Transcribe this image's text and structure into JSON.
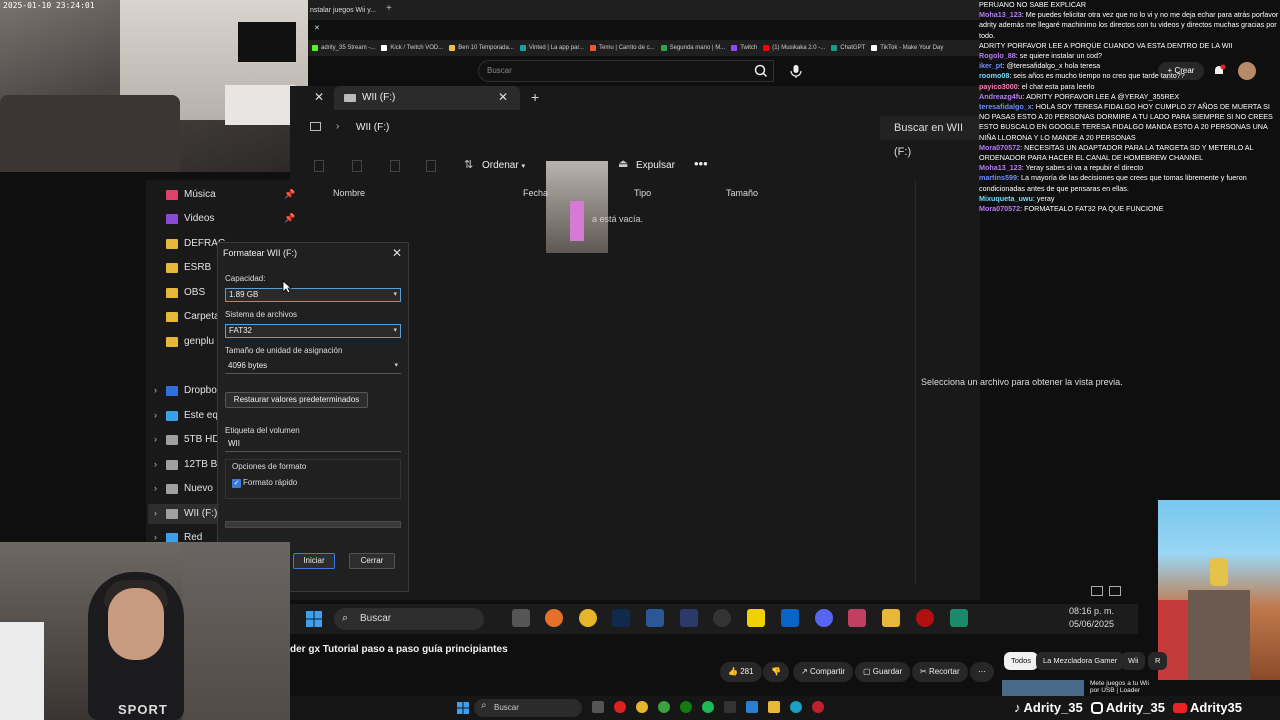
{
  "webcam_top": {
    "timestamp": "2025-01-10 23:24:01"
  },
  "browser": {
    "tab_label": "nstalar juegos Wii y...",
    "search_placeholder": "Buscar",
    "bookmarks": [
      "adrity_35 Stream -...",
      "Kick / Twitch VOD...",
      "Ben 10 Temporada...",
      "Vinted | La app par...",
      "Temu | Carrito de c...",
      "Segunda mano | M...",
      "Twitch",
      "(1) Musikaka 2.0 -...",
      "ChatGPT",
      "TikTok - Make Your Day"
    ],
    "bookmark_colors": [
      "#53fc18",
      "#ffffff",
      "#f0c040",
      "#1aa0a0",
      "#f05a28",
      "#2ea44f",
      "#9146ff",
      "#ff0000",
      "#10a37f",
      "#ffffff"
    ],
    "crear_label": "Crear"
  },
  "explorer": {
    "tab_title": "WII (F:)",
    "address": "WII (F:)",
    "search_label": "Buscar en WII (F:)",
    "toolbar": {
      "ordenar": "Ordenar",
      "expulsar": "Expulsar"
    },
    "columns": {
      "name": "Nombre",
      "date": "Fecha",
      "type": "Tipo",
      "size": "Tamaño"
    },
    "empty_message": "a está vacía.",
    "preview_message": "Selecciona un archivo para obtener la vista previa.",
    "sidebar": [
      {
        "label": "Música",
        "color": "#e0406a",
        "pinned": true
      },
      {
        "label": "Videos",
        "color": "#8a4ad8",
        "pinned": true
      },
      {
        "label": "DEFRAG",
        "color": "#e8b73a",
        "pinned": false
      },
      {
        "label": "ESRB",
        "color": "#e8b73a",
        "pinned": false
      },
      {
        "label": "OBS",
        "color": "#e8b73a",
        "pinned": false
      },
      {
        "label": "Carpeta",
        "color": "#e8b73a",
        "pinned": false
      },
      {
        "label": "genplu",
        "color": "#e8b73a",
        "pinned": false
      },
      {
        "label": "Dropbo",
        "color": "#2f6fe0",
        "pinned": false
      },
      {
        "label": "Este eq",
        "color": "#3aa0e8",
        "pinned": false
      },
      {
        "label": "5TB HD",
        "color": "#a0a0a0",
        "pinned": false
      },
      {
        "label": "12TB B",
        "color": "#a0a0a0",
        "pinned": false
      },
      {
        "label": "Nuevo",
        "color": "#a0a0a0",
        "pinned": false
      },
      {
        "label": "WII (F:)",
        "color": "#a0a0a0",
        "pinned": false
      },
      {
        "label": "Red",
        "color": "#3aa0e8",
        "pinned": false
      }
    ]
  },
  "dialog": {
    "title": "Formatear WII (F:)",
    "capacity_label": "Capacidad:",
    "capacity_value": "1.89 GB",
    "fs_label": "Sistema de archivos",
    "fs_value": "FAT32",
    "alloc_label": "Tamaño de unidad de asignación",
    "alloc_value": "4096 bytes",
    "restore_button": "Restaurar valores predeterminados",
    "volume_label": "Etiqueta del volumen",
    "volume_value": "WII",
    "options_label": "Opciones de formato",
    "quick_format_label": "Formato rápido",
    "quick_format_checked": true,
    "progress": 0,
    "start_button": "Iniciar",
    "close_button": "Cerrar"
  },
  "inner_taskbar": {
    "search": "Buscar",
    "time": "08:16 p. m.",
    "date": "05/06/2025"
  },
  "chat": [
    {
      "user": "",
      "text": "PERUANO NO SABE EXPLICAR",
      "color": "#ffffff"
    },
    {
      "user": "Moha13_123",
      "text": ": Me puedes felicitar otra vez que no lo vi y no me deja echar para atrás porfavor adrity además me llegaré machinimo los directos con tu videos y directos muchas gracias por todo.",
      "color": "#b57cf5"
    },
    {
      "user": "",
      "text": "ADRITY PORFAVOR LEE A PORQUE CUANDO VA ESTA DENTRO DE LA WII",
      "color": "#ffffff"
    },
    {
      "user": "Rogolo_88",
      "text": ": se quiere instalar un cod?",
      "color": "#b57cf5"
    },
    {
      "user": "iker_pt",
      "text": ": @teresafidalgo_x hola teresa",
      "color": "#6f8cff"
    },
    {
      "user": "roomo08",
      "text": ": seis años es mucho tiempo no creo que tarde tanto??",
      "color": "#6fdcff"
    },
    {
      "user": "payico3000",
      "text": ": el chat esta para leerlo",
      "color": "#ff7ab8"
    },
    {
      "user": "Andreazg4fu",
      "text": ": ADRITY PORFAVOR LEE A @YERAY_355REX",
      "color": "#b57cf5"
    },
    {
      "user": "teresafidalgo_x",
      "text": ": HOLA SOY TERESA FIDALGO HOY CUMPLO 27 AÑOS DE MUERTA SI NO PASAS ESTO A 20 PERSONAS DORMIRE A TU LADO PARA SIEMPRE SI NO CREES ESTO BUSCALO EN GOOGLE TERESA FIDALGO MANDA ESTO A 20 PERSONAS UNA NIÑA LLORONA Y LO MANDE A 20 PERSONAS",
      "color": "#6f8cff"
    },
    {
      "user": "Mora070572",
      "text": ": NECESITAS UN ADAPTADOR PARA LA TARGETA SD Y METERLO AL ORDENADOR PARA HACER EL CANAL DE HOMEBREW CHANNEL",
      "color": "#b57cf5"
    },
    {
      "user": "Moha13_123",
      "text": ": Yeray sabes si va a repubir el directo",
      "color": "#b57cf5"
    },
    {
      "user": "martins599",
      "text": ": La mayoría de las decisiones que crees que tomas libremente y fueron condicionadas antes de que pensaras en ellas.",
      "color": "#6f8cff"
    },
    {
      "user": "Mixuqueta_uwu",
      "text": ": yeray",
      "color": "#6fdcff"
    },
    {
      "user": "Mora070572",
      "text": ": FORMATEALO FAT32 PA QUE FUNCIONE",
      "color": "#b57cf5"
    }
  ],
  "youtube": {
    "video_title": "der gx Tutorial paso a paso guía principiantes",
    "likes": "281",
    "share": "Compartir",
    "save": "Guardar",
    "clip": "Recortar",
    "chips": [
      "Todos",
      "La Mezcladora Gamer",
      "Wii",
      "R"
    ],
    "recommended_title": "Mete juegos a tu Wii por USB | Loader"
  },
  "webcam_bottom": {
    "hoodie_text": "SPORT"
  },
  "os_taskbar": {
    "search": "Buscar"
  },
  "socials": [
    "Adrity_35",
    "Adrity_35",
    "Adrity35"
  ]
}
